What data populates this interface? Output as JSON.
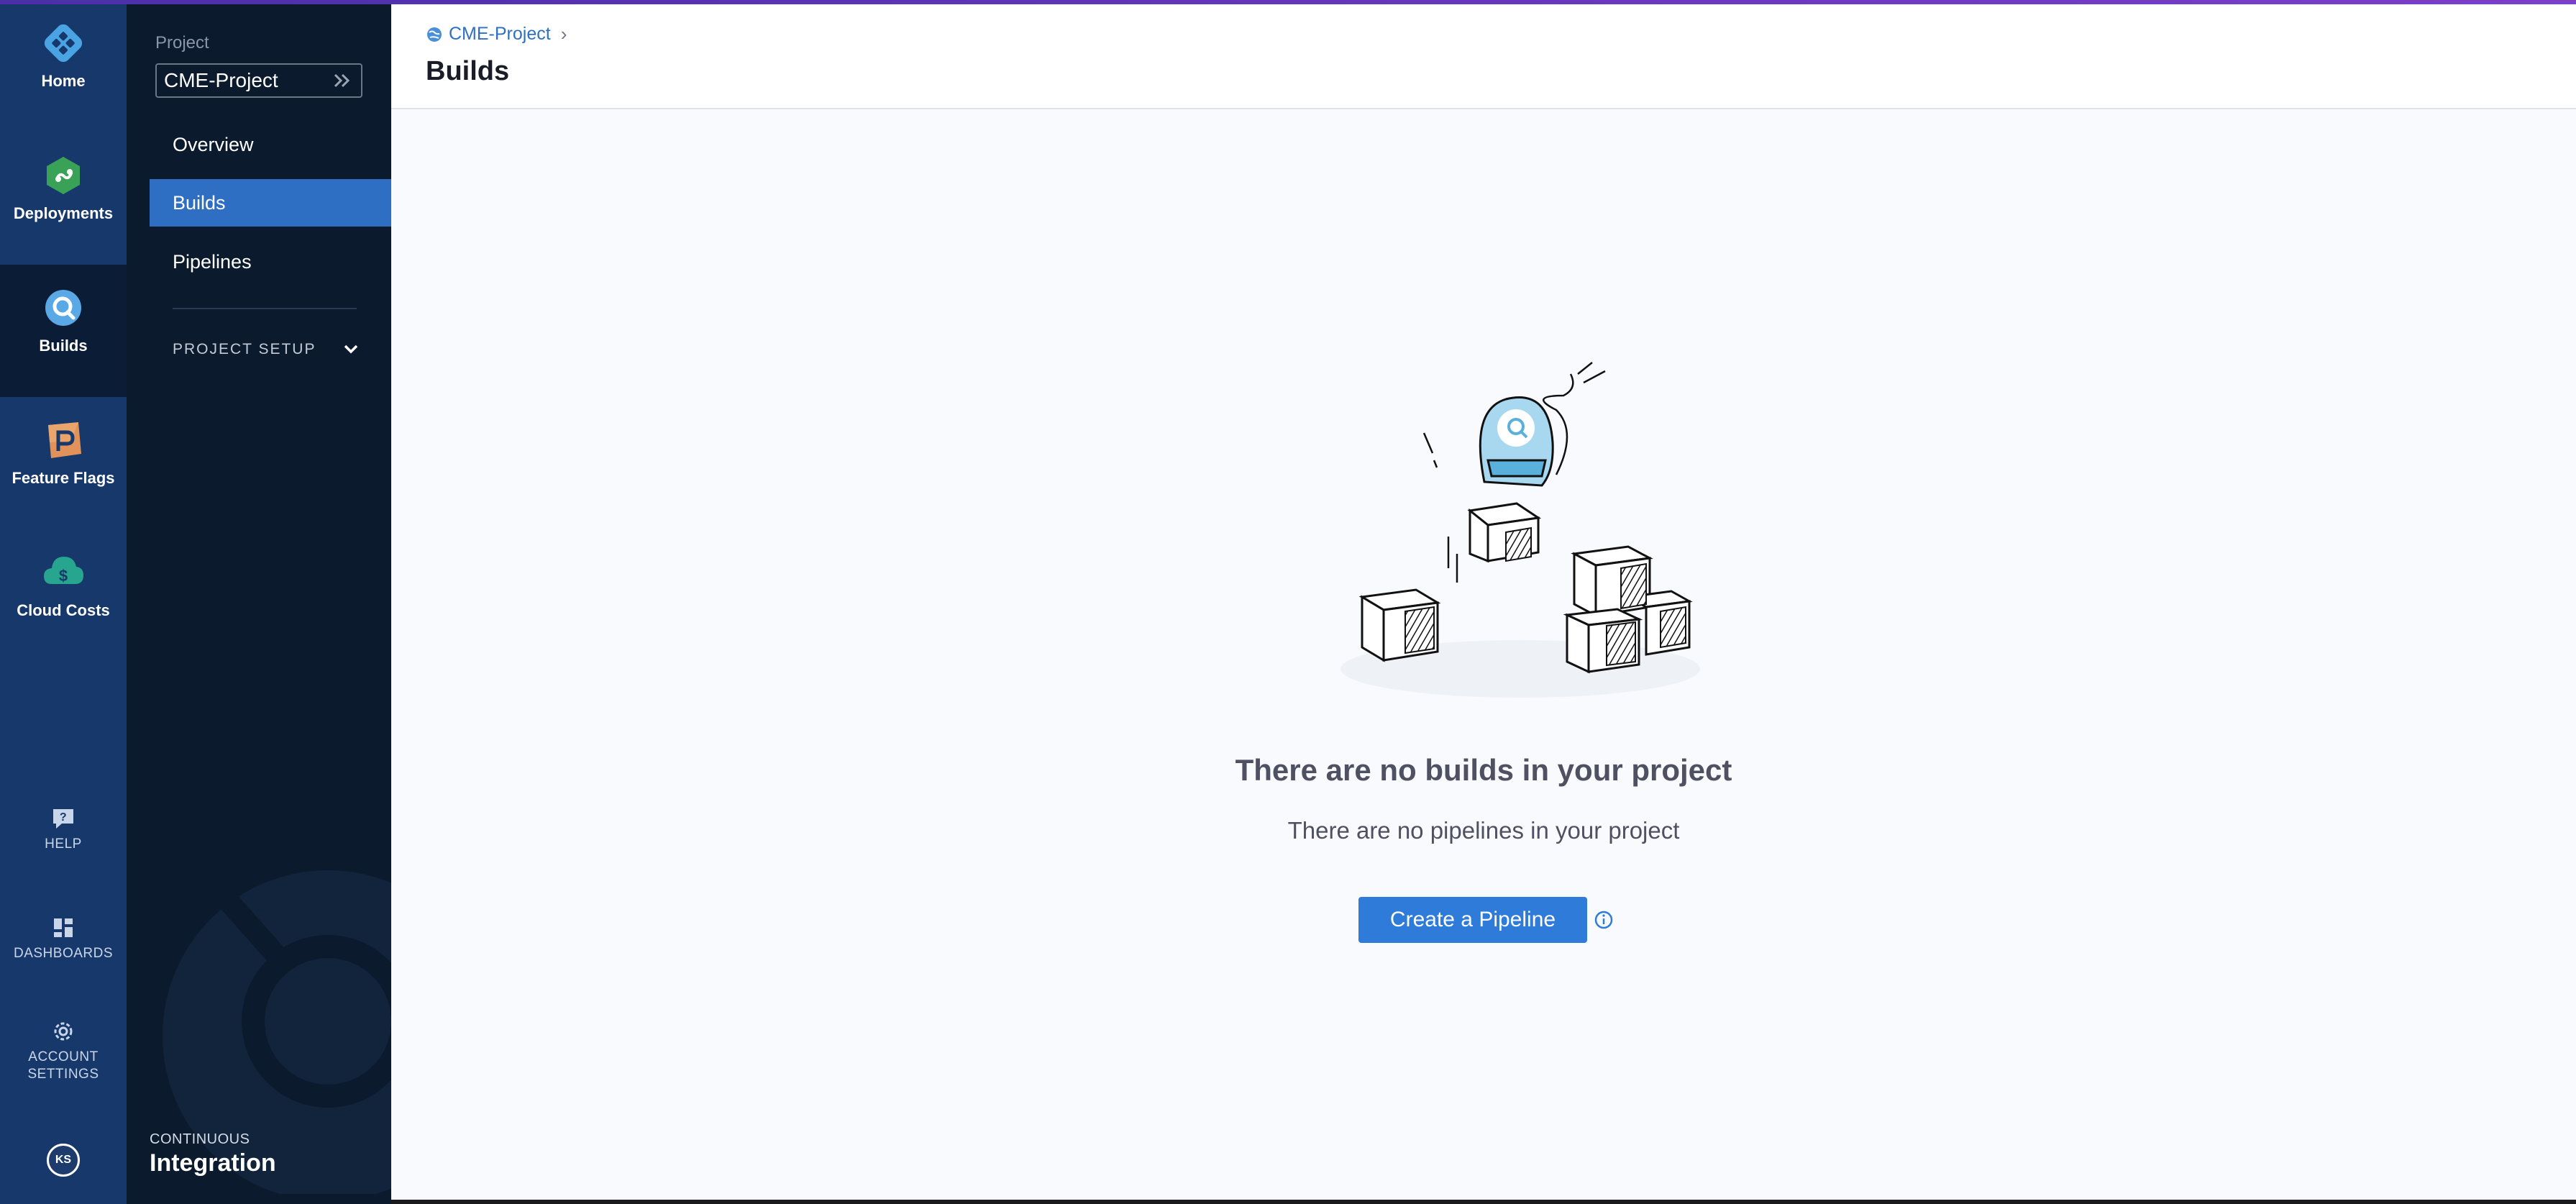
{
  "rail": {
    "items": [
      {
        "label": "Home",
        "icon": "harness-logo-icon"
      },
      {
        "label": "Deployments",
        "icon": "deployments-icon"
      },
      {
        "label": "Builds",
        "icon": "builds-icon",
        "active": true
      },
      {
        "label": "Feature Flags",
        "icon": "feature-flags-icon"
      },
      {
        "label": "Cloud Costs",
        "icon": "cloud-costs-icon"
      }
    ],
    "utilities": {
      "help": "HELP",
      "dashboards": "DASHBOARDS",
      "account_settings_line1": "ACCOUNT",
      "account_settings_line2": "SETTINGS"
    },
    "avatar_initials": "KS"
  },
  "sidebar": {
    "project_label": "Project",
    "project_value": "CME-Project",
    "nav": [
      {
        "label": "Overview"
      },
      {
        "label": "Builds",
        "active": true
      },
      {
        "label": "Pipelines"
      }
    ],
    "project_setup": "PROJECT SETUP",
    "module_small": "CONTINUOUS",
    "module_big": "Integration"
  },
  "header": {
    "breadcrumb": "CME-Project",
    "title": "Builds"
  },
  "empty_state": {
    "title": "There are no builds in your project",
    "subtitle": "There are no pipelines in your project",
    "cta_label": "Create a Pipeline"
  },
  "colors": {
    "rail_bg": "#17386b",
    "sidebar_bg": "#0c1a2e",
    "active_nav": "#2e6fc4",
    "cta": "#2e7bd9",
    "top_accent": "#6a3bc0"
  }
}
